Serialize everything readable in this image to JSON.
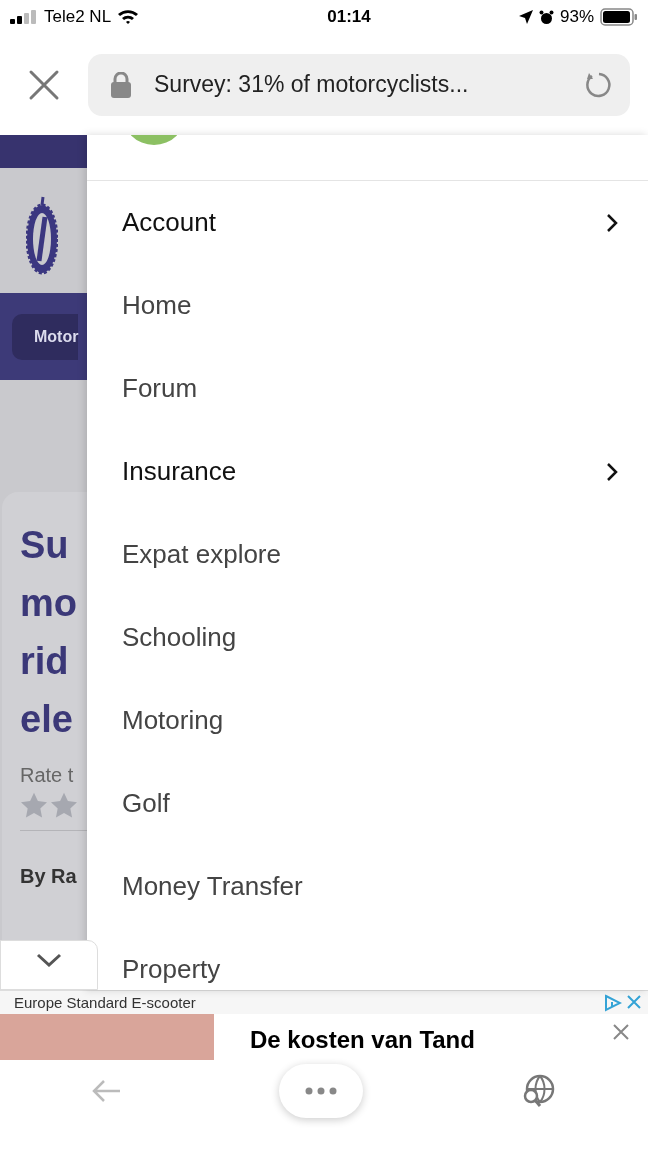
{
  "status_bar": {
    "carrier": "Tele2 NL",
    "time": "01:14",
    "battery": "93%"
  },
  "address_bar": {
    "title": "Survey: 31% of motorcyclists..."
  },
  "background_page": {
    "breadcrumb": "Motor",
    "headline_lines": [
      "Su",
      "mo",
      "rid",
      "ele"
    ],
    "rate_label": "Rate t",
    "byline": "By Ra"
  },
  "menu": {
    "items": [
      {
        "label": "Account",
        "expandable": true
      },
      {
        "label": "Home",
        "expandable": false
      },
      {
        "label": "Forum",
        "expandable": false
      },
      {
        "label": "Insurance",
        "expandable": true
      },
      {
        "label": "Expat explore",
        "expandable": false
      },
      {
        "label": "Schooling",
        "expandable": false
      },
      {
        "label": "Motoring",
        "expandable": false
      },
      {
        "label": "Golf",
        "expandable": false
      },
      {
        "label": "Money Transfer",
        "expandable": false
      },
      {
        "label": "Property",
        "expandable": false
      }
    ]
  },
  "ads": {
    "strip_text": "Europe Standard E-scooter",
    "headline": "De kosten van Tand"
  }
}
